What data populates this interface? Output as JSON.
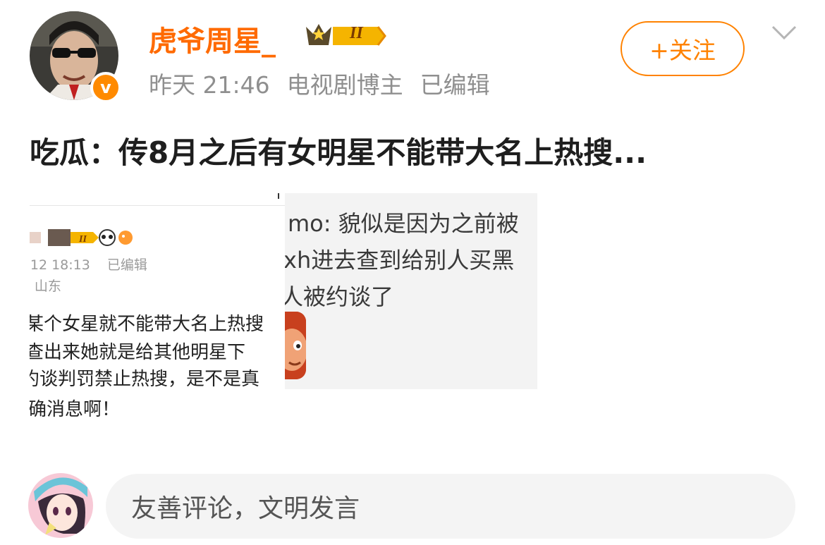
{
  "header": {
    "username": "虎爷周星_",
    "level_badge": "II",
    "time": "昨天 21:46",
    "tag": "电视剧博主",
    "edited": "已编辑",
    "follow_label": "+关注",
    "verified_mark": "v"
  },
  "post": {
    "text": "吃瓜：传8月之后有女明星不能带大名上热搜..."
  },
  "image_left": {
    "badge_level": "II",
    "time": "-12 18:13",
    "edited": "已编辑",
    "location": "- 山东",
    "lines": [
      "某个女星就不能带大名上热搜",
      "  查出来她就是给其他明星下",
      "约谈判罚禁止热搜，是不是真",
      "确消息啊！"
    ]
  },
  "image_right": {
    "lines": [
      "mo: 貌似是因为之前被",
      "xh进去查到给别人买黑",
      "人被约谈了"
    ]
  },
  "comment": {
    "placeholder": "友善评论，文明发言"
  },
  "colors": {
    "accent": "#ff8200",
    "username": "#ff6a00",
    "meta_gray": "#8f8f8f"
  }
}
